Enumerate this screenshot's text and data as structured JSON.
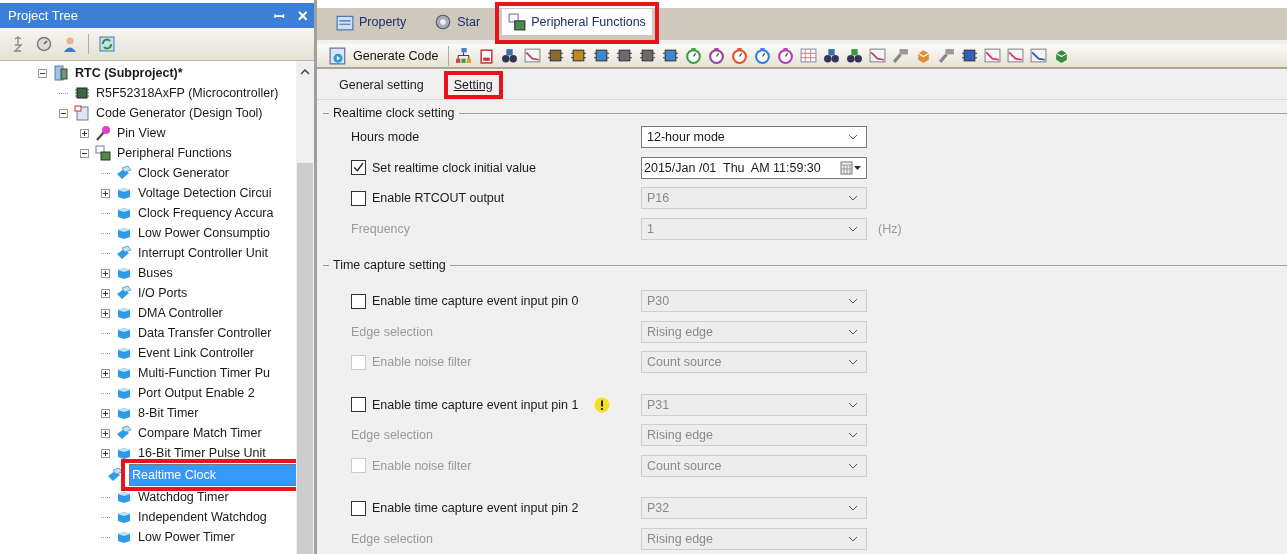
{
  "project_tree": {
    "title": "Project Tree",
    "pin_glyph": "ꟷ",
    "close_glyph": "×",
    "nodes": [
      {
        "label": "RTC (Subproject)*",
        "kind": "project",
        "bold": true,
        "expanded": true,
        "selected": false,
        "children": [
          {
            "label": "R5F52318AxFP (Microcontroller)",
            "kind": "chip",
            "selected": false
          },
          {
            "label": "Code Generator (Design Tool)",
            "kind": "codegen",
            "expanded": true,
            "selected": false,
            "children": [
              {
                "label": "Pin View",
                "kind": "pin",
                "expanded": false,
                "selected": false
              },
              {
                "label": "Peripheral Functions",
                "kind": "peripheral",
                "expanded": true,
                "selected": false,
                "children": [
                  {
                    "label": "Clock Generator",
                    "kind": "module-edit",
                    "selected": false
                  },
                  {
                    "label": "Voltage Detection Circui",
                    "kind": "module",
                    "expanded": false,
                    "selected": false
                  },
                  {
                    "label": "Clock Frequency Accura",
                    "kind": "module",
                    "selected": false
                  },
                  {
                    "label": "Low Power Consumptio",
                    "kind": "module",
                    "selected": false
                  },
                  {
                    "label": "Interrupt Controller Unit",
                    "kind": "module-edit",
                    "selected": false
                  },
                  {
                    "label": "Buses",
                    "kind": "module",
                    "expanded": false,
                    "selected": false
                  },
                  {
                    "label": "I/O Ports",
                    "kind": "module-edit",
                    "expanded": false,
                    "selected": false
                  },
                  {
                    "label": "DMA Controller",
                    "kind": "module",
                    "expanded": false,
                    "selected": false
                  },
                  {
                    "label": "Data Transfer Controller",
                    "kind": "module",
                    "selected": false
                  },
                  {
                    "label": "Event Link Controller",
                    "kind": "module",
                    "selected": false
                  },
                  {
                    "label": "Multi-Function Timer Pu",
                    "kind": "module",
                    "expanded": false,
                    "selected": false
                  },
                  {
                    "label": "Port Output Enable 2",
                    "kind": "module",
                    "selected": false
                  },
                  {
                    "label": "8-Bit Timer",
                    "kind": "module",
                    "expanded": false,
                    "selected": false
                  },
                  {
                    "label": "Compare Match Timer",
                    "kind": "module-edit",
                    "expanded": false,
                    "selected": false
                  },
                  {
                    "label": "16-Bit Timer Pulse Unit",
                    "kind": "module",
                    "expanded": false,
                    "selected": false
                  },
                  {
                    "label": "Realtime Clock",
                    "kind": "module-edit",
                    "selected": true,
                    "highlighted": true
                  },
                  {
                    "label": "Watchdog Timer",
                    "kind": "module",
                    "selected": false
                  },
                  {
                    "label": "Independent Watchdog",
                    "kind": "module",
                    "selected": false
                  },
                  {
                    "label": "Low Power Timer",
                    "kind": "module",
                    "selected": false
                  }
                ]
              }
            ]
          }
        ]
      }
    ]
  },
  "tabs": [
    {
      "label": "Property",
      "kind": "property",
      "selected": false,
      "highlighted": false
    },
    {
      "label": "Star",
      "kind": "start",
      "selected": false,
      "highlighted": false
    },
    {
      "label": "Peripheral Functions",
      "kind": "peripheral",
      "selected": true,
      "highlighted": true
    }
  ],
  "toolbar": {
    "generate_button": "Generate Code"
  },
  "subtabs": [
    {
      "label": "General setting",
      "selected": false,
      "highlighted": false
    },
    {
      "label": "Setting",
      "selected": true,
      "highlighted": true
    }
  ],
  "sections": [
    {
      "title": "Realtime clock setting",
      "groups": [
        [
          {
            "kind": "select",
            "label": "Hours mode",
            "value": "12-hour mode",
            "disabled": false
          },
          {
            "kind": "check-datetime",
            "label": "Set realtime clock initial value",
            "checked": true,
            "value": "2015/Jan /01  Thu  AM 11:59:30",
            "disabled": false,
            "field_disabled": false
          },
          {
            "kind": "check-select",
            "label": "Enable RTCOUT output",
            "checked": false,
            "value": "P16",
            "disabled": false,
            "field_disabled": true
          },
          {
            "kind": "select",
            "label": "Frequency",
            "value": "1",
            "disabled": true,
            "unit": "(Hz)"
          }
        ]
      ]
    },
    {
      "title": "Time capture setting",
      "groups": [
        [
          {
            "kind": "check-select",
            "label": "Enable time capture event input pin 0",
            "checked": false,
            "value": "P30",
            "disabled": false,
            "field_disabled": true
          },
          {
            "kind": "select",
            "label": "Edge selection",
            "value": "Rising edge",
            "disabled": true
          },
          {
            "kind": "check-select",
            "label": "Enable noise filter",
            "checked": false,
            "value": "Count source",
            "disabled": true,
            "field_disabled": true
          }
        ],
        [
          {
            "kind": "check-select",
            "label": "Enable time capture event input pin 1",
            "checked": false,
            "value": "P31",
            "disabled": false,
            "field_disabled": true,
            "warning": true
          },
          {
            "kind": "select",
            "label": "Edge selection",
            "value": "Rising edge",
            "disabled": true
          },
          {
            "kind": "check-select",
            "label": "Enable noise filter",
            "checked": false,
            "value": "Count source",
            "disabled": true,
            "field_disabled": true
          }
        ],
        [
          {
            "kind": "check-select",
            "label": "Enable time capture event input pin 2",
            "checked": false,
            "value": "P32",
            "disabled": false,
            "field_disabled": true
          },
          {
            "kind": "select",
            "label": "Edge selection",
            "value": "Rising edge",
            "disabled": true
          }
        ]
      ]
    }
  ]
}
